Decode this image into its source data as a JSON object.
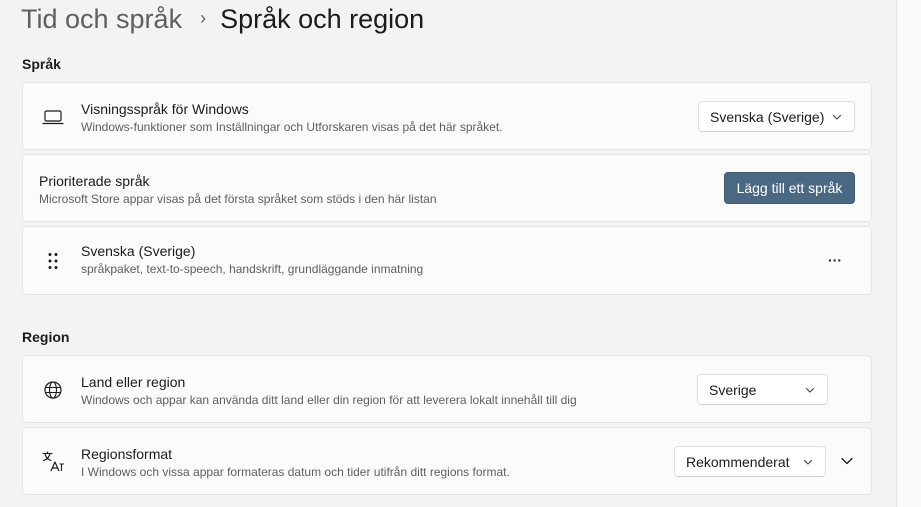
{
  "breadcrumb": {
    "parent": "Tid och språk",
    "separator": "›",
    "current": "Språk och region"
  },
  "language_section": {
    "title": "Språk",
    "display_language": {
      "icon": "laptop-icon",
      "title": "Visningsspråk för Windows",
      "description": "Windows-funktioner som Inställningar och Utforskaren visas på det här språket.",
      "dropdown_value": "Svenska (Sverige)"
    },
    "preferred_languages": {
      "title": "Prioriterade språk",
      "description": "Microsoft Store appar visas på det första språket som stöds i den här listan",
      "button_label": "Lägg till ett språk"
    },
    "installed_language": {
      "icon": "drag-handle-icon",
      "title": "Svenska (Sverige)",
      "description": "språkpaket, text-to-speech, handskrift, grundläggande inmatning",
      "more_label": "···"
    }
  },
  "region_section": {
    "title": "Region",
    "country": {
      "icon": "globe-icon",
      "title": "Land eller region",
      "description": "Windows och appar kan använda ditt land eller din region för att leverera lokalt innehåll till dig",
      "dropdown_value": "Sverige"
    },
    "regional_format": {
      "icon": "regional-format-icon",
      "title": "Regionsformat",
      "description": "I Windows och vissa appar formateras datum och tider utifrån ditt regions format.",
      "dropdown_value": "Rekommenderat"
    }
  },
  "colors": {
    "accent_button": "#4a6784",
    "background": "#f3f3f3",
    "card": "#fbfbfb"
  }
}
